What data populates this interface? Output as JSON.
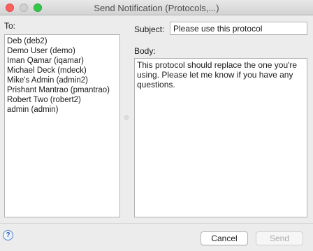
{
  "window": {
    "title": "Send Notification (Protocols,...)"
  },
  "recipients": {
    "label": "To:",
    "items": [
      "Deb (deb2)",
      "Demo User (demo)",
      "Iman Qamar (iqamar)",
      "Michael Deck (mdeck)",
      "Mike's Admin (admin2)",
      "Prishant Mantrao (pmantrao)",
      "Robert Two (robert2)",
      "admin (admin)"
    ]
  },
  "subject": {
    "label": "Subject:",
    "value": "Please use this protocol"
  },
  "body": {
    "label": "Body:",
    "value": "This protocol should replace the one you're using. Please let me know if you have any questions."
  },
  "footer": {
    "help_icon": "?",
    "cancel_label": "Cancel",
    "send_label": "Send"
  }
}
